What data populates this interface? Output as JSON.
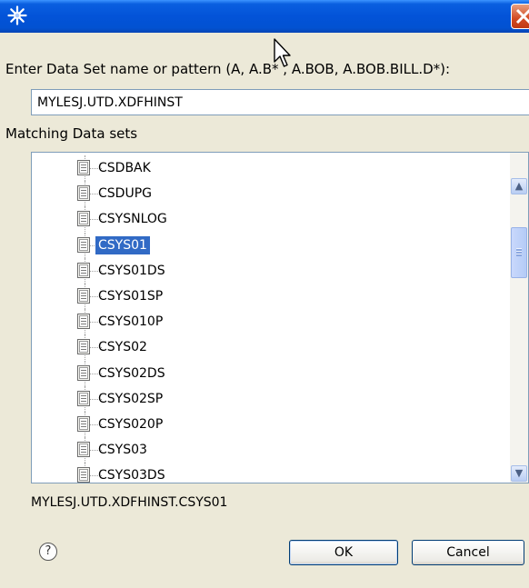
{
  "window": {
    "title": "",
    "app_icon": "star-burst-icon",
    "close_icon": "close-x-icon"
  },
  "prompt": {
    "label": "Enter Data Set name or pattern (A, A.B* , A.BOB,  A.BOB.BILL.D*):"
  },
  "input": {
    "value": "MYLESJ.UTD.XDFHINST"
  },
  "matching": {
    "label": "Matching Data sets"
  },
  "tree": {
    "items": [
      {
        "label": "CSDBAK"
      },
      {
        "label": "CSDUPG"
      },
      {
        "label": "CSYSNLOG"
      },
      {
        "label": "CSYS01",
        "selected": true
      },
      {
        "label": "CSYS01DS"
      },
      {
        "label": "CSYS01SP"
      },
      {
        "label": "CSYS010P"
      },
      {
        "label": "CSYS02"
      },
      {
        "label": "CSYS02DS"
      },
      {
        "label": "CSYS02SP"
      },
      {
        "label": "CSYS020P"
      },
      {
        "label": "CSYS03"
      },
      {
        "label": "CSYS03DS"
      }
    ]
  },
  "status": {
    "path": "MYLESJ.UTD.XDFHINST.CSYS01"
  },
  "buttons": {
    "help": "?",
    "ok": "OK",
    "cancel": "Cancel"
  },
  "colors": {
    "title_bar": "#0353d8",
    "selection": "#316ac5",
    "dialog_bg": "#ece9d8"
  }
}
